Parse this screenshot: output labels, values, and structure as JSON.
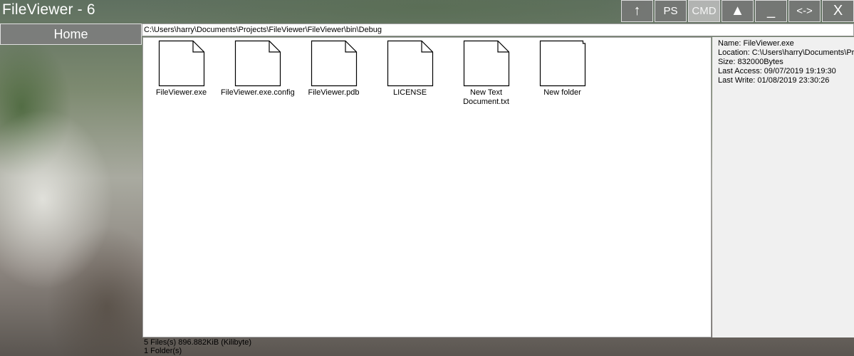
{
  "window": {
    "title": "FileViewer - 6"
  },
  "title_buttons": [
    {
      "name": "up-button",
      "label": "↑",
      "icon": "up-arrow-icon"
    },
    {
      "name": "ps-button",
      "label": "PS"
    },
    {
      "name": "cmd-button",
      "label": "CMD",
      "active": true
    },
    {
      "name": "maximize-button",
      "label": "▲",
      "icon": "triangle-up-icon"
    },
    {
      "name": "minimize-button",
      "label": "_"
    },
    {
      "name": "toggle-panel-button",
      "label": "<->"
    },
    {
      "name": "close-button",
      "label": "X",
      "icon": "close-icon"
    }
  ],
  "sidebar": {
    "home_label": "Home"
  },
  "path_bar": {
    "value": "C:\\Users\\harry\\Documents\\Projects\\FileViewer\\FileViewer\\bin\\Debug"
  },
  "files": [
    {
      "label": "FileViewer.exe",
      "type": "file"
    },
    {
      "label": "FileViewer.exe.config",
      "type": "file"
    },
    {
      "label": "FileViewer.pdb",
      "type": "file"
    },
    {
      "label": "LICENSE",
      "type": "file"
    },
    {
      "label": "New Text Document.txt",
      "type": "file"
    },
    {
      "label": "New folder",
      "type": "folder"
    }
  ],
  "info": {
    "name": "Name: FileViewer.exe",
    "location": "Location: C:\\Users\\harry\\Documents\\Projects\\FileViewer\\FileViewer\\bin\\Debug",
    "size": "Size: 832000Bytes",
    "last_access": "Last Access: 09/07/2019 19:19:30",
    "last_write": "Last Write: 01/08/2019 23:30:26"
  },
  "status": {
    "files_summary": "5 Files(s) 896.882KiB (Kilibyte)",
    "folders_summary": "1 Folder(s)"
  },
  "colors": {
    "accent_button": "#7a7a7a",
    "active_button": "#bebebe",
    "panel_bg": "#f0f0f0",
    "content_bg": "#ffffff"
  }
}
